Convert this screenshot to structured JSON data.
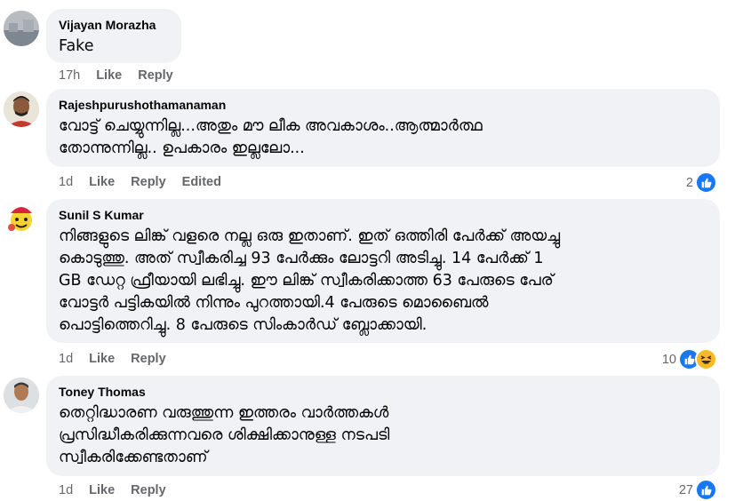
{
  "comments": [
    {
      "author": "Vijayan Morazha",
      "text": "Fake",
      "time": "17h",
      "like_label": "Like",
      "reply_label": "Reply"
    },
    {
      "author": "Rajeshpurushothamanaman",
      "text": "വോട്ട് ചെയ്യുന്നില്ല...അതും മൗ ലീക അവകാശം..ആത്മാർത്ഥ\nതോന്നുന്നില്ല.. ഉപകാരം ഇല്ലലോ...",
      "time": "1d",
      "like_label": "Like",
      "reply_label": "Reply",
      "edited_label": "Edited",
      "reaction_count": "2"
    },
    {
      "author": "Sunil S Kumar",
      "text": "നിങ്ങളുടെ ലിങ്ക് വളരെ നല്ല ഒരു ഇതാണ്. ഇത് ഒത്തിരി പേർക്ക് അയച്ചു\nകൊടുത്തു. അത് സ്വീകരിച്ച 93 പേർക്കും ലോട്ടറി അടിച്ചു. 14 പേർക്ക് 1\nGB ഡേറ്റ ഫ്രീയായി ലഭിച്ചു. ഈ ലിങ്ക് സ്വീകരിക്കാത്ത 63 പേരുടെ പേര്\nവോട്ടർ പട്ടികയിൽ നിന്നും പുറത്തായി.4 പേരുടെ മൊബൈൽ\nപൊട്ടിത്തെറിച്ചു. 8 പേരുടെ സിംകാർഡ് ബ്ലോക്കായി.",
      "time": "1d",
      "like_label": "Like",
      "reply_label": "Reply",
      "reaction_count": "10"
    },
    {
      "author": "Toney Thomas",
      "text": "തെറ്റിദ്ധാരണ വരുത്തുന്ന ഇത്തരം വാർത്തകൾ\nപ്രസിദ്ധീകരിക്കുന്നവരെ ശിക്ഷിക്കാനുള്ള നടപടി\nസ്വീകരിക്കേണ്ടതാണ്",
      "time": "1d",
      "like_label": "Like",
      "reply_label": "Reply",
      "reaction_count": "27"
    }
  ],
  "colors": {
    "bubble": "#f0f2f5",
    "meta": "#65676b",
    "like_blue": "#1877f2",
    "haha_yellow": "#f7b928"
  },
  "icons": [
    "like-reaction-icon",
    "haha-reaction-icon"
  ]
}
